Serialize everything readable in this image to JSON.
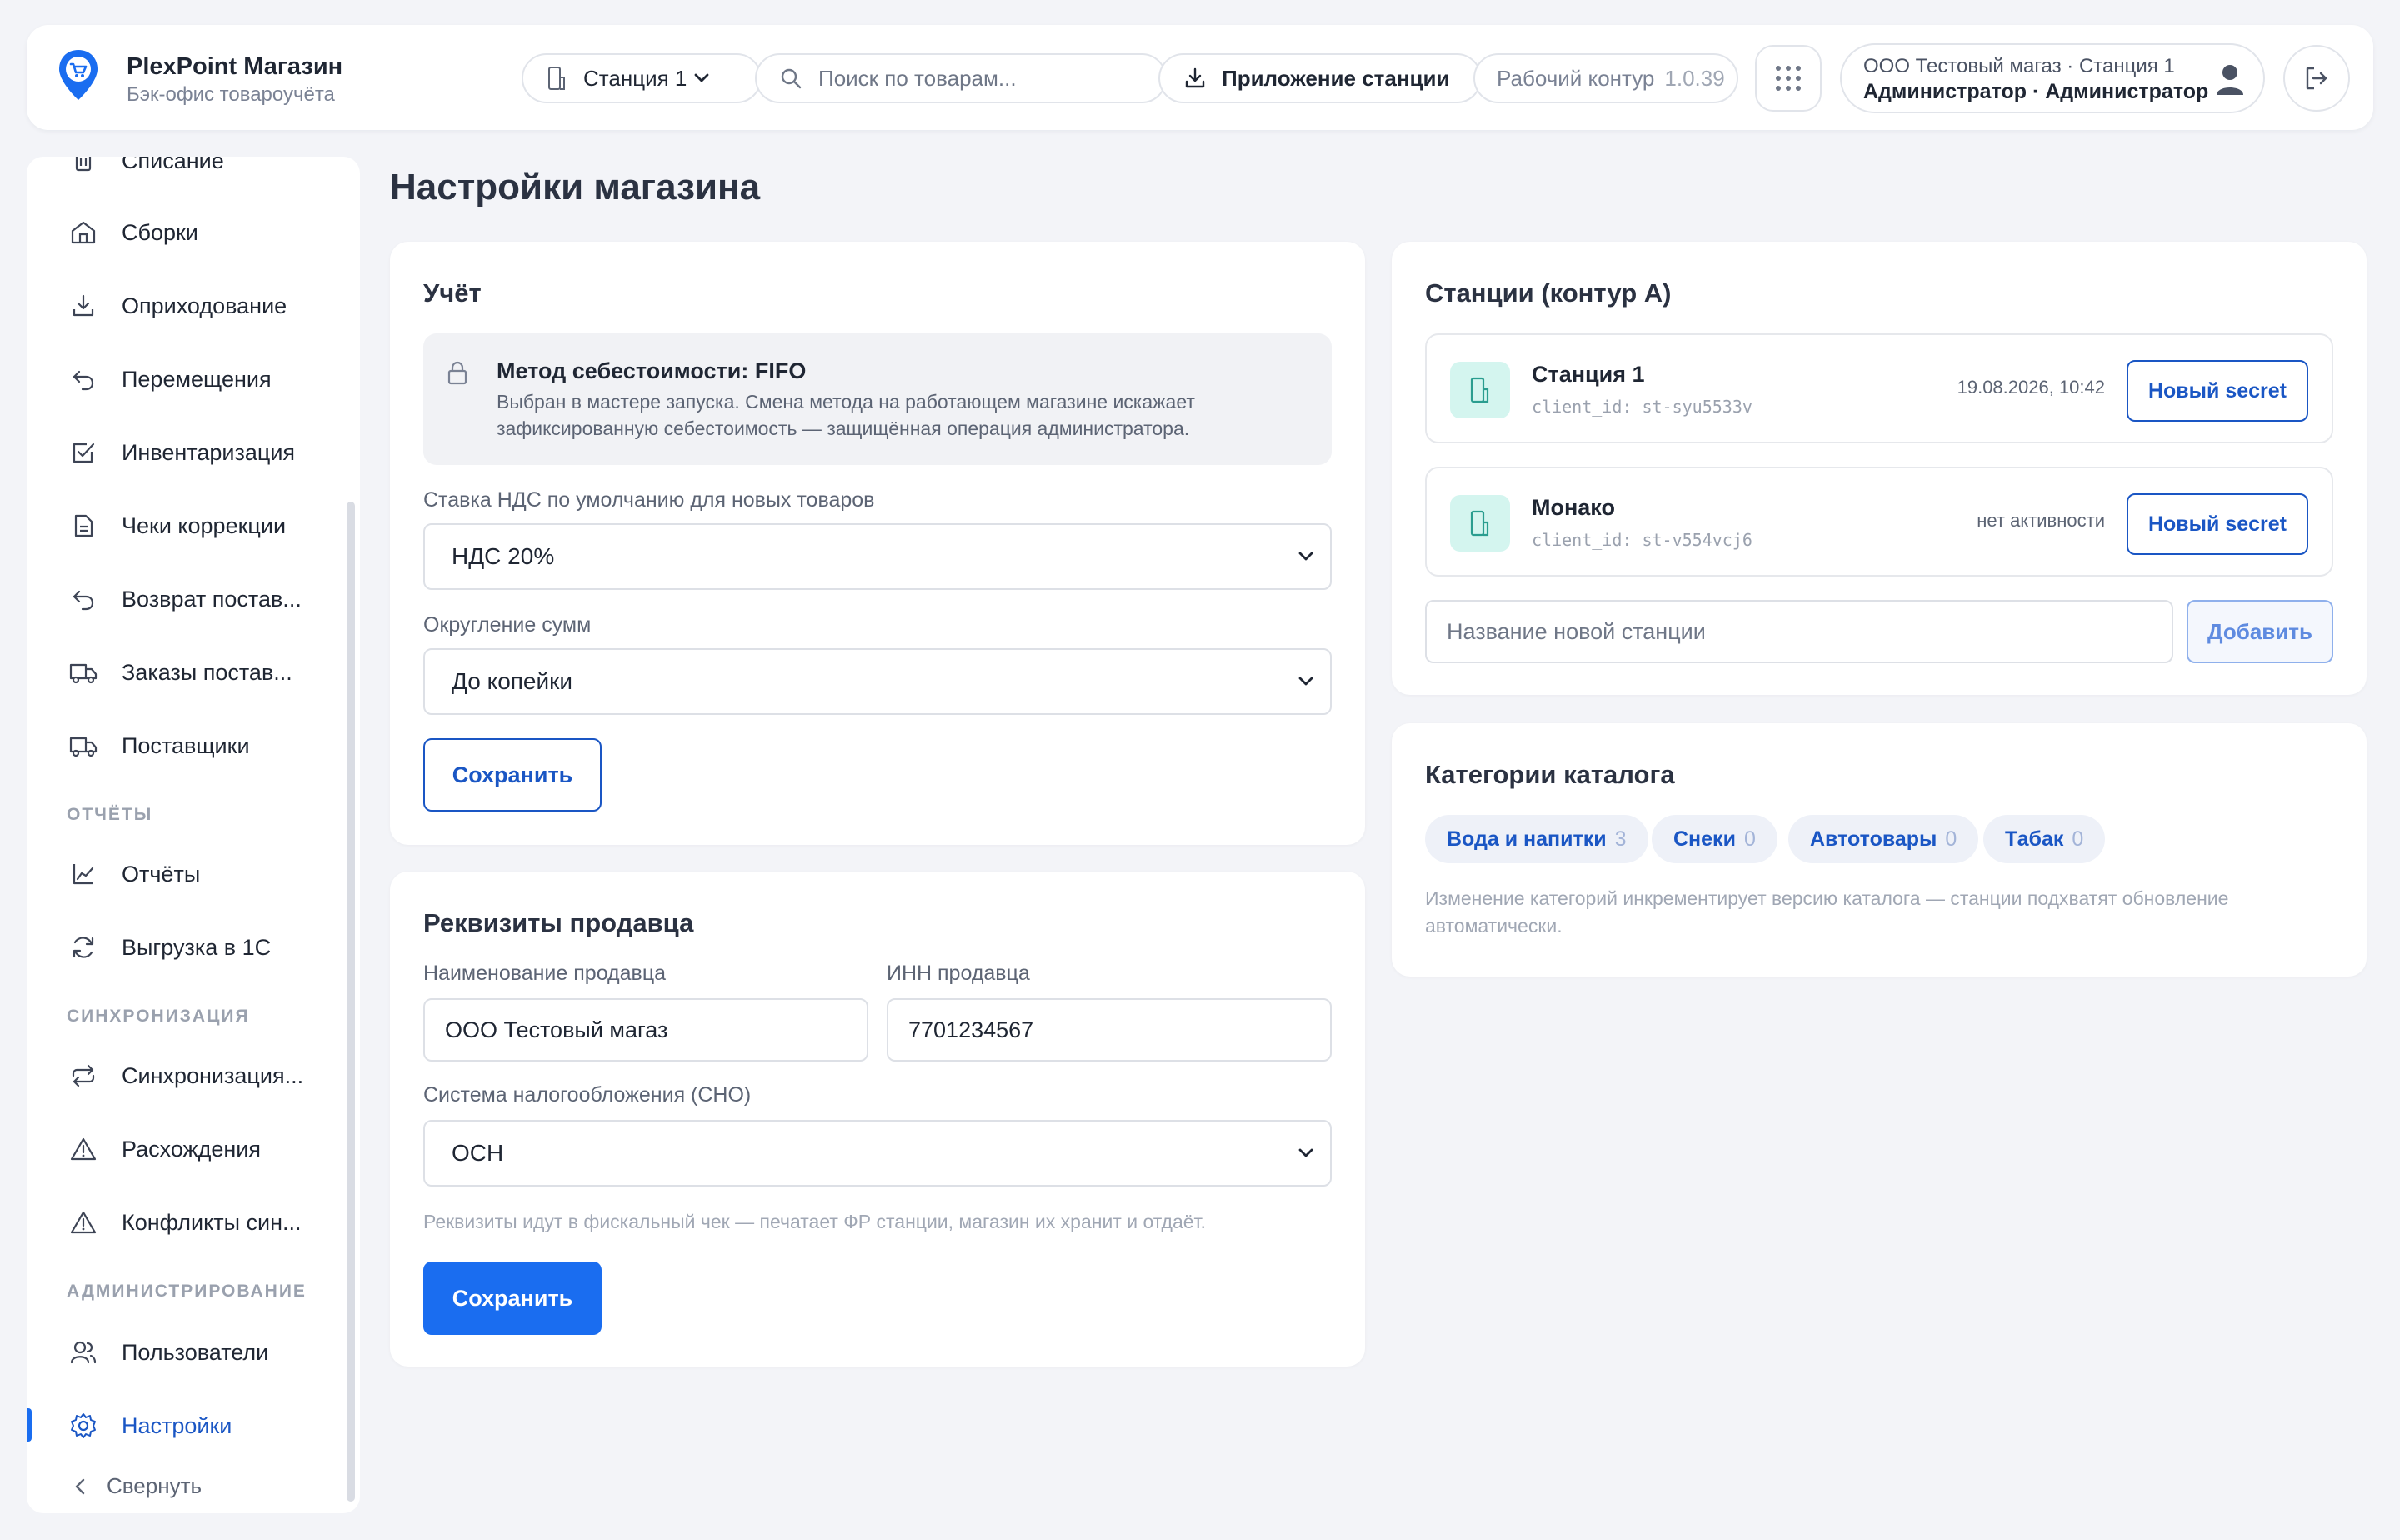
{
  "brand": {
    "title": "PlexPoint Магазин",
    "subtitle": "Бэк-офис товароучёта"
  },
  "header": {
    "station_label": "Станция 1",
    "search_placeholder": "Поиск по товарам...",
    "app_label": "Приложение станции",
    "env_label": "Рабочий контур",
    "env_version": "1.0.39",
    "user_line1": "ООО Тестовый магаз · Станция 1",
    "user_line2": "Администратор · Администратор"
  },
  "sidebar": {
    "items": [
      {
        "label": "Списание",
        "icon": "trash-icon"
      },
      {
        "label": "Сборки",
        "icon": "home-icon"
      },
      {
        "label": "Оприходование",
        "icon": "download-icon"
      },
      {
        "label": "Перемещения",
        "icon": "undo-icon"
      },
      {
        "label": "Инвентаризация",
        "icon": "checkbox-icon"
      },
      {
        "label": "Чеки коррекции",
        "icon": "document-icon"
      },
      {
        "label": "Возврат постав...",
        "icon": "undo-icon"
      },
      {
        "label": "Заказы постав...",
        "icon": "truck-icon"
      },
      {
        "label": "Поставщики",
        "icon": "truck-icon"
      },
      {
        "label": "Отчёты",
        "icon": "chart-line-icon"
      },
      {
        "label": "Выгрузка в 1С",
        "icon": "refresh-icon"
      },
      {
        "label": "Синхронизация...",
        "icon": "sync-icon"
      },
      {
        "label": "Расхождения",
        "icon": "warning-icon"
      },
      {
        "label": "Конфликты син...",
        "icon": "warning-icon"
      },
      {
        "label": "Пользователи",
        "icon": "users-icon"
      },
      {
        "label": "Настройки",
        "icon": "gear-icon"
      }
    ],
    "sections": {
      "reports": "ОТЧЁТЫ",
      "sync": "СИНХРОНИЗАЦИЯ",
      "admin": "АДМИНИСТРИРОВАНИЕ"
    },
    "collapse_label": "Свернуть",
    "active": "Настройки"
  },
  "page": {
    "title": "Настройки магазина"
  },
  "accounting": {
    "title": "Учёт",
    "info_title": "Метод себестоимости: FIFO",
    "info_desc": "Выбран в мастере запуска. Смена метода на работающем магазине искажает зафиксированную себестоимость — защищённая операция администратора.",
    "vat_label": "Ставка НДС по умолчанию для новых товаров",
    "vat_value": "НДС 20%",
    "rounding_label": "Округление сумм",
    "rounding_value": "До копейки",
    "save_label": "Сохранить"
  },
  "seller": {
    "title": "Реквизиты продавца",
    "name_label": "Наименование продавца",
    "name_value": "ООО Тестовый магаз",
    "inn_label": "ИНН продавца",
    "inn_value": "7701234567",
    "tax_label": "Система налогообложения (СНО)",
    "tax_value": "ОСН",
    "note": "Реквизиты идут в фискальный чек — печатает ФР станции, магазин их хранит и отдаёт.",
    "save_label": "Сохранить"
  },
  "stations": {
    "title": "Станции (контур A)",
    "items": [
      {
        "name": "Станция 1",
        "client_id": "client_id: st-syu5533v",
        "activity": "19.08.2026, 10:42",
        "button": "Новый secret"
      },
      {
        "name": "Монако",
        "client_id": "client_id: st-v554vcj6",
        "activity": "нет активности",
        "button": "Новый secret"
      }
    ],
    "new_placeholder": "Название новой станции",
    "add_label": "Добавить"
  },
  "categories": {
    "title": "Категории каталога",
    "items": [
      {
        "name": "Вода и напитки",
        "count": "3"
      },
      {
        "name": "Снеки",
        "count": "0"
      },
      {
        "name": "Автотовары",
        "count": "0"
      },
      {
        "name": "Табак",
        "count": "0"
      }
    ],
    "note": "Изменение категорий инкрементирует версию каталога — станции подхватят обновление автоматически."
  },
  "colors": {
    "accent": "#1a6df0",
    "accent_dark": "#1a56c4",
    "station_icon_bg": "#d4f5ef"
  }
}
